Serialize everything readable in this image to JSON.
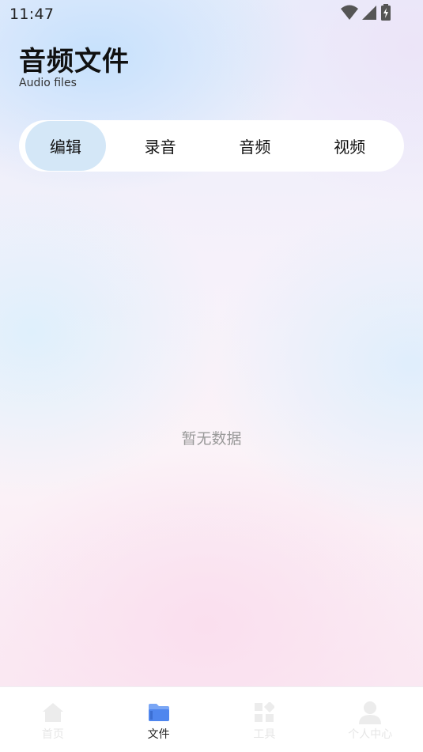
{
  "status_bar": {
    "time": "11:47",
    "icons": [
      "wifi-icon",
      "cellular-signal-icon",
      "battery-charging-icon"
    ]
  },
  "header": {
    "title": "音频文件",
    "subtitle": "Audio files"
  },
  "tabs": [
    {
      "label": "编辑",
      "active": true
    },
    {
      "label": "录音",
      "active": false
    },
    {
      "label": "音频",
      "active": false
    },
    {
      "label": "视频",
      "active": false
    }
  ],
  "main": {
    "empty_text": "暂无数据"
  },
  "bottom_nav": {
    "items": [
      {
        "label": "首页",
        "icon": "home-icon",
        "active": false
      },
      {
        "label": "文件",
        "icon": "folder-icon",
        "active": true
      },
      {
        "label": "工具",
        "icon": "tools-grid-icon",
        "active": false
      },
      {
        "label": "个人中心",
        "icon": "user-icon",
        "active": false
      }
    ]
  },
  "colors": {
    "active_tab_bg": "#d4e7f7",
    "active_nav_icon": "#5b8def",
    "inactive_nav": "#e6e6e6",
    "empty_text": "#999999"
  }
}
